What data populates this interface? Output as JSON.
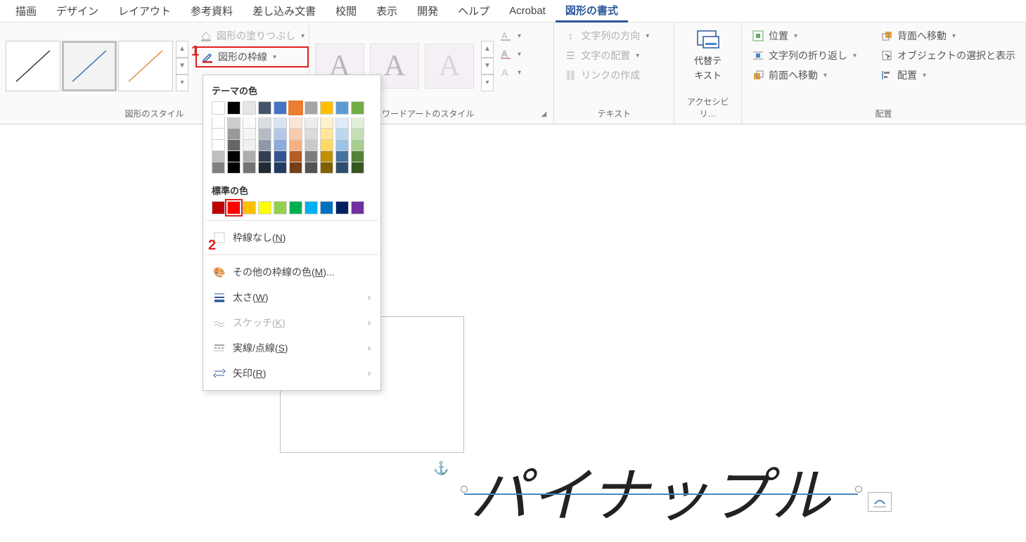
{
  "menubar": {
    "items": [
      "描画",
      "デザイン",
      "レイアウト",
      "参考資料",
      "差し込み文書",
      "校閲",
      "表示",
      "開発",
      "ヘルプ",
      "Acrobat",
      "図形の書式"
    ],
    "active_index": 10
  },
  "ribbon": {
    "group_shape_styles": {
      "label": "図形のスタイル"
    },
    "fill_btn": "図形の塗りつぶし",
    "outline_btn": "図形の枠線",
    "group_wordart": {
      "label": "ワードアートのスタイル"
    },
    "text_group": {
      "label": "テキスト",
      "dir": "文字列の方向",
      "align": "文字の配置",
      "link": "リンクの作成"
    },
    "alt_text": {
      "line1": "代替テ",
      "line2": "キスト",
      "group_label": "アクセシビリ…"
    },
    "arrange": {
      "label": "配置",
      "position": "位置",
      "wrap": "文字列の折り返し",
      "front": "前面へ移動",
      "back": "背面へ移動",
      "select": "オブジェクトの選択と表示",
      "align": "配置"
    }
  },
  "dropdown": {
    "theme_title": "テーマの色",
    "standard_title": "標準の色",
    "no_outline": "枠線なし(",
    "no_outline_key": "N",
    "no_outline_end": ")",
    "more_colors": "その他の枠線の色(",
    "more_colors_key": "M",
    "more_colors_end": ")...",
    "weight": "太さ(",
    "weight_key": "W",
    "weight_end": ")",
    "sketch": "スケッチ(",
    "sketch_key": "K",
    "sketch_end": ")",
    "dashes": "実線/点線(",
    "dashes_key": "S",
    "dashes_end": ")",
    "arrows": "矢印(",
    "arrows_key": "R",
    "arrows_end": ")",
    "theme_row": [
      "#ffffff",
      "#000000",
      "#e7e6e6",
      "#44546a",
      "#4472c4",
      "#ed7d31",
      "#a5a5a5",
      "#ffc000",
      "#5b9bd5",
      "#70ad47"
    ],
    "standard_row": [
      "#c00000",
      "#ff0000",
      "#ffc000",
      "#ffff00",
      "#92d050",
      "#00b050",
      "#00b0f0",
      "#0070c0",
      "#002060",
      "#7030a0"
    ],
    "theme_selected_index": 5,
    "standard_selected_index": 1
  },
  "annotations": {
    "one": "1",
    "two": "2"
  },
  "document": {
    "text": "パイナップル"
  }
}
